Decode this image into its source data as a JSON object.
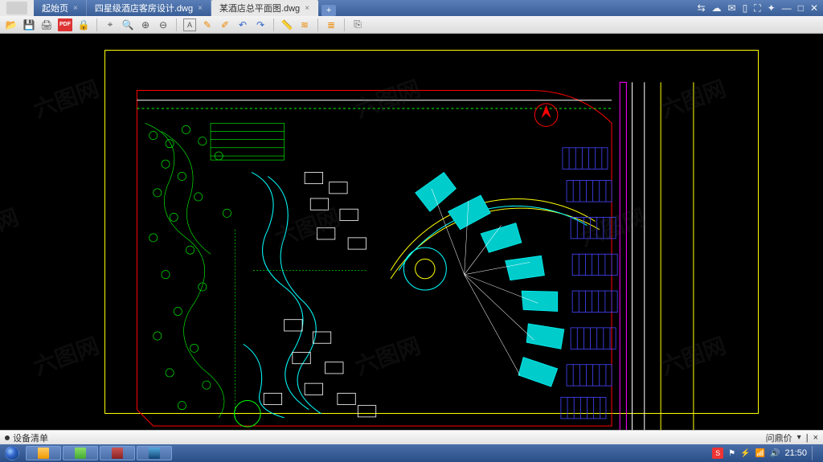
{
  "tabs": [
    {
      "label": "起始页",
      "active": false
    },
    {
      "label": "四星级酒店客房设计.dwg",
      "active": false
    },
    {
      "label": "某酒店总平面图.dwg",
      "active": true
    }
  ],
  "toolbar": {
    "pdf": "PDF"
  },
  "status": {
    "left": "设备清单",
    "right": "问鼎价"
  },
  "tray": {
    "s": "S",
    "time": "21:50"
  },
  "watermark": "六图网"
}
